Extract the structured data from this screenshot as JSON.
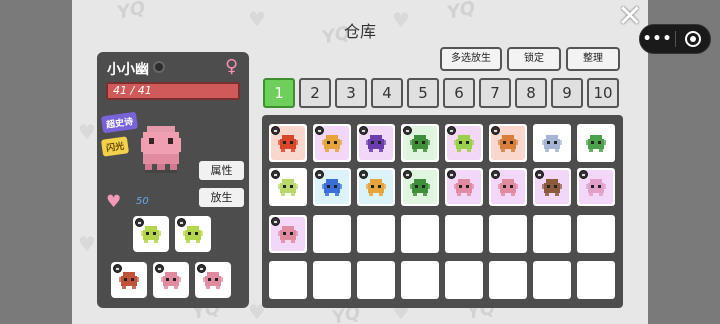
{
  "title": "仓库",
  "close_label": "✕",
  "menu": {
    "more_label": "•••"
  },
  "pet": {
    "name": "小小幽",
    "hp": "41 / 41",
    "hp_fraction": 1.0,
    "rarity_tag": "超史诗",
    "shiny_tag": "闪光",
    "affection": "50",
    "buttons": {
      "attributes": "属性",
      "release": "放生"
    }
  },
  "actions": {
    "multi_release": "多选放生",
    "lock": "锁定",
    "sort": "整理"
  },
  "tabs": [
    "1",
    "2",
    "3",
    "4",
    "5",
    "6",
    "7",
    "8",
    "9",
    "10"
  ],
  "active_tab": 0,
  "colors": {
    "panel": "#4d4d4d",
    "active_tab": "#6fcf5b",
    "hp_bar": "#c24a4a",
    "rarity_tag": "#7a63d9",
    "shiny_tag": "#f3d14a"
  },
  "team": [
    {
      "name": "mantis",
      "color": "#b4d64a",
      "bg": "#e9b6f2",
      "locked": true
    },
    {
      "name": "mantis",
      "color": "#b4d64a",
      "bg": "#e9b6f2",
      "locked": true
    }
  ],
  "bench": [
    {
      "name": "lizard",
      "color": "#c0523a",
      "bg": "#f6b7a4",
      "locked": true
    },
    {
      "name": "ghost-blob",
      "color": "#e08ba0",
      "bg": "#f6b7a4",
      "locked": true
    },
    {
      "name": "ghost-blob",
      "color": "#e08ba0",
      "bg": "#f6b7a4",
      "locked": true
    }
  ],
  "storage": [
    {
      "name": "fire-bird",
      "color": "#d9452b",
      "bg": "#f6b7a4",
      "locked": true
    },
    {
      "name": "imp",
      "color": "#e6a53a",
      "bg": "#e9b6f2",
      "locked": true
    },
    {
      "name": "bat-wing",
      "color": "#6a3cb0",
      "bg": "#e9b6f2",
      "locked": true
    },
    {
      "name": "frog",
      "color": "#3f8f3a",
      "bg": "#c7ecc4",
      "locked": true
    },
    {
      "name": "leaf-cat",
      "color": "#9bd14a",
      "bg": "#e9b6f2",
      "locked": true
    },
    {
      "name": "fox",
      "color": "#d97d3a",
      "bg": "#f6b7a4",
      "locked": true
    },
    {
      "name": "robot-ghost",
      "color": "#a5b4d4",
      "bg": "#ffffff",
      "locked": false
    },
    {
      "name": "croc",
      "color": "#4aa34a",
      "bg": "#ffffff",
      "locked": false
    },
    {
      "name": "leaf-sprite",
      "color": "#b8d86b",
      "bg": "#ffffff",
      "locked": true
    },
    {
      "name": "beetle",
      "color": "#3a6ed9",
      "bg": "#bde9f2",
      "locked": true
    },
    {
      "name": "bee",
      "color": "#e6a53a",
      "bg": "#bde9f2",
      "locked": true
    },
    {
      "name": "frog",
      "color": "#3f8f3a",
      "bg": "#c7ecc4",
      "locked": true
    },
    {
      "name": "ghost-blob",
      "color": "#e08ba0",
      "bg": "#e9b6f2",
      "locked": true
    },
    {
      "name": "ghost-blob",
      "color": "#e08ba0",
      "bg": "#e9b6f2",
      "locked": true
    },
    {
      "name": "acorn",
      "color": "#8b5a3a",
      "bg": "#e9b6f2",
      "locked": true
    },
    {
      "name": "moth",
      "color": "#e0a0c8",
      "bg": "#e9b6f2",
      "locked": true
    },
    {
      "name": "ghost-blob",
      "color": "#e08ba0",
      "bg": "#e9b6f2",
      "locked": true
    },
    null,
    null,
    null,
    null,
    null,
    null,
    null,
    null,
    null,
    null,
    null,
    null,
    null,
    null,
    null
  ]
}
